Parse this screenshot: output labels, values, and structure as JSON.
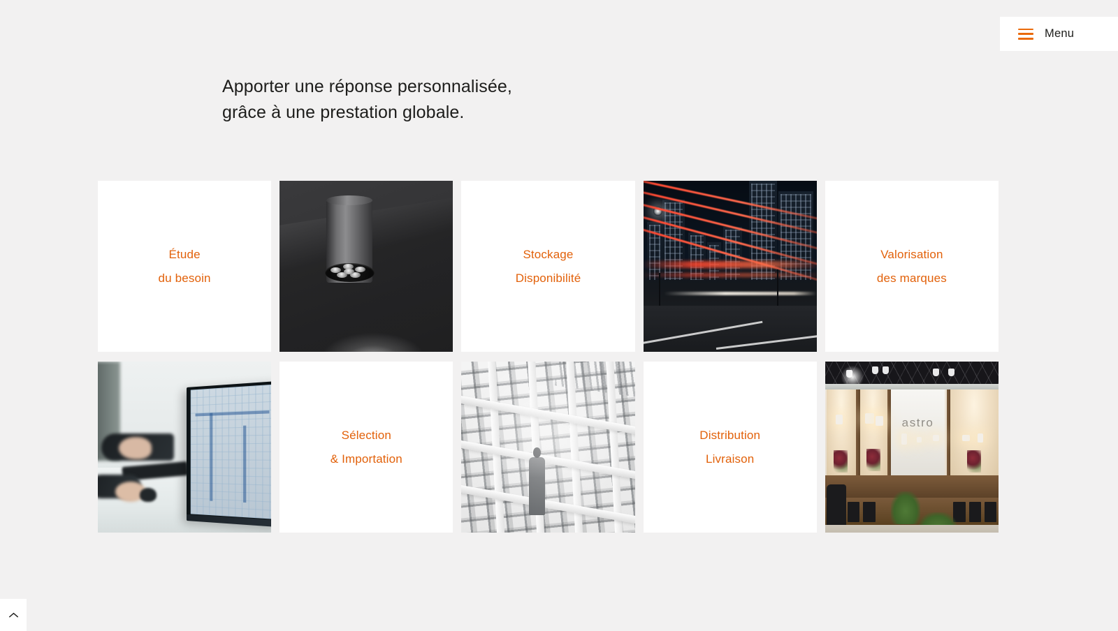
{
  "page": {
    "background_color": "#f2f1f1",
    "accent_color": "#e2610a"
  },
  "header": {
    "menu_label": "Menu",
    "menu_icon": "hamburger-icon"
  },
  "heading": {
    "line1": "Apporter une réponse personnalisée,",
    "line2": "grâce à une prestation globale.",
    "full": "Apporter une réponse personnalisée,\ngrâce à une prestation globale."
  },
  "grid": {
    "columns": 5,
    "rows": 2,
    "cells": [
      {
        "type": "text",
        "name": "etude-du-besoin",
        "line1": "Étude",
        "line2": "du besoin"
      },
      {
        "type": "image",
        "name": "ceiling-downlight-photo",
        "alt": "Dark cylindrical LED ceiling downlight"
      },
      {
        "type": "text",
        "name": "stockage-disponibilite",
        "line1": "Stockage",
        "line2": "Disponibilité"
      },
      {
        "type": "image",
        "name": "night-city-traffic-photo",
        "alt": "Night city skyline with red light trails"
      },
      {
        "type": "text",
        "name": "valorisation-des-marques",
        "line1": "Valorisation",
        "line2": "des marques"
      },
      {
        "type": "image",
        "name": "design-desk-photo",
        "alt": "Designer at desk with CAD drawing on monitor"
      },
      {
        "type": "text",
        "name": "selection-importation",
        "line1": "Sélection",
        "line2": "& Importation"
      },
      {
        "type": "image",
        "name": "warehouse-racking-photo",
        "alt": "White warehouse racking with worker"
      },
      {
        "type": "text",
        "name": "distribution-livraison",
        "line1": "Distribution",
        "line2": "Livraison"
      },
      {
        "type": "image",
        "name": "astro-showroom-photo",
        "alt": "Astro lighting showroom display",
        "brand": "astro"
      }
    ]
  },
  "footer": {
    "scroll_top_icon": "chevron-up-icon"
  }
}
